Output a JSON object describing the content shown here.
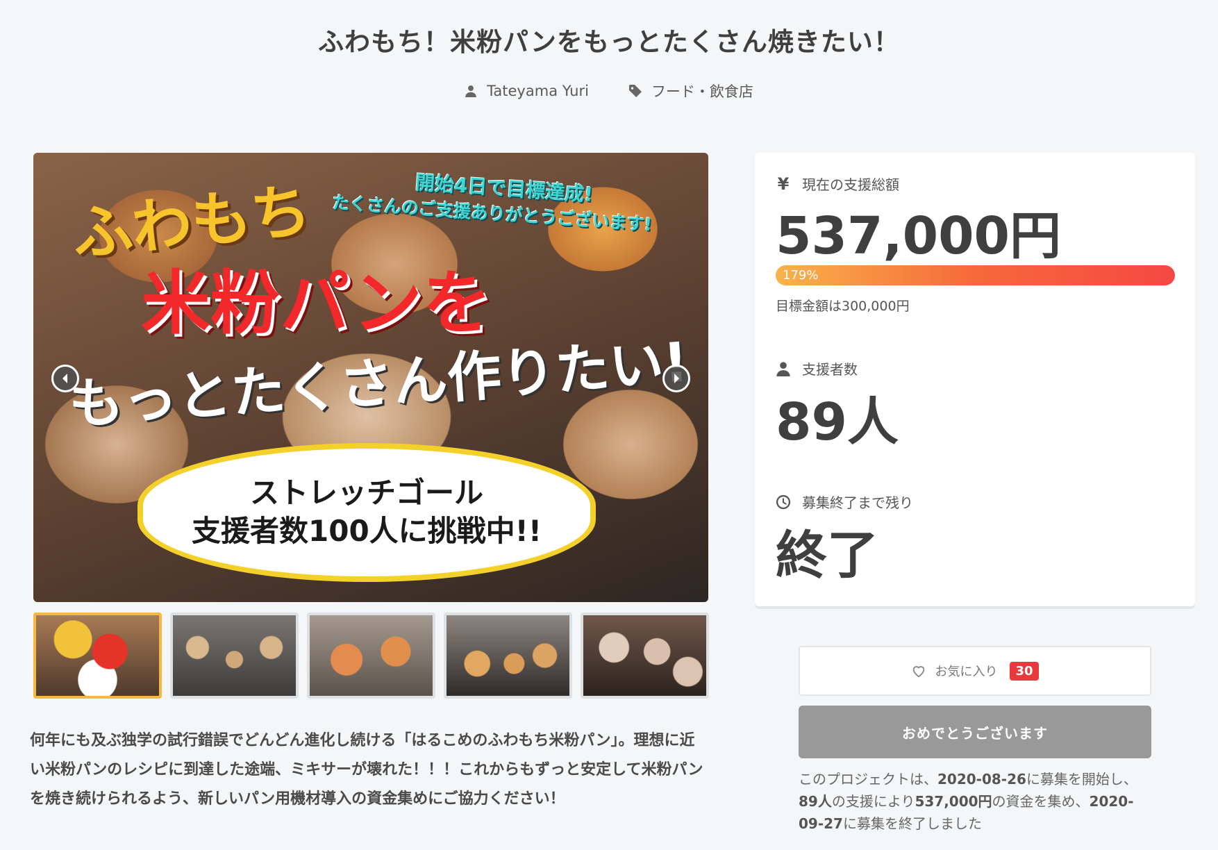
{
  "project": {
    "title": "ふわもち！米粉パンをもっとたくさん焼きたい！",
    "author": "Tateyama Yuri",
    "category": "フード・飲食店"
  },
  "hero": {
    "catch_green_1": "開始4日で目標達成!",
    "catch_green_2": "たくさんのご支援ありがとうございます!",
    "catch_yellow": "ふわもち",
    "catch_red": "米粉パンを",
    "catch_white": "もっとたくさん作りたい!",
    "burst_line_1": "ストレッチゴール",
    "burst_line_2": "支援者数100人に挑戦中!!"
  },
  "thumb_thumb_caption": {
    "line_1": "ふわもち",
    "line_2": "米粉パンを",
    "line_3": "もっとたくさん作りたい!",
    "line_4": "ストレッチゴール",
    "line_5": "支援者数100人に挑戦中!!"
  },
  "description": "何年にも及ぶ独学の試行錯誤でどんどん進化し続ける「はるこめのふわもち米粉パン」。理想に近い米粉パンのレシピに到達した途端、ミキサーが壊れた！！！これからもずっと安定して米粉パンを焼き続けられるよう、新しいパン用機材導入の資金集めにご協力ください！",
  "stats": {
    "yen_symbol": "¥",
    "total_label": "現在の支援総額",
    "total_amount": "537,000円",
    "progress_text": "179%",
    "progress_percent": 179,
    "goal_text": "目標金額は300,000円",
    "backers_label": "支援者数",
    "backers_count": "89人",
    "remaining_label": "募集終了まで残り",
    "remaining_value": "終了"
  },
  "actions": {
    "favorite_label": "お気に入り",
    "favorite_count": "30",
    "congrats_label": "おめでとうございます"
  },
  "summary": {
    "p1": "このプロジェクトは、",
    "start_date": "2020-08-26",
    "p2": "に募集を開始し、",
    "backers": "89人",
    "p3": "の支援により",
    "amount": "537,000円",
    "p4": "の資金を集め、",
    "end_date": "2020-09-27",
    "p5": "に募集を終了しました"
  },
  "colors": {
    "accent_red": "#e8393d",
    "progress_start": "#f9b34a",
    "progress_end": "#f54844",
    "thumb_active": "#f5b942"
  }
}
